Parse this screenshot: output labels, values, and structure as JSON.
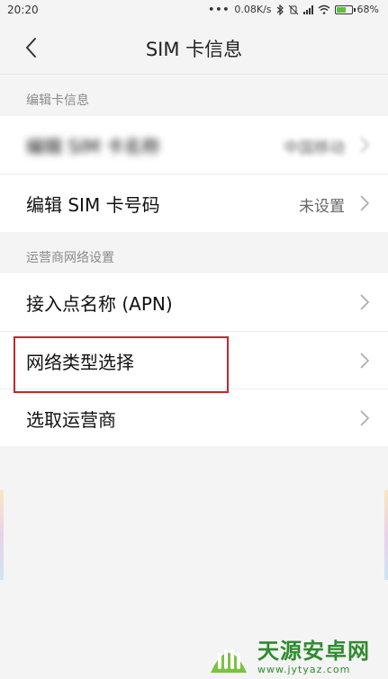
{
  "status_bar": {
    "time": "20:20",
    "dots": "•••",
    "net_speed": "0.08K/s",
    "battery": "68%",
    "battery_level": 0.68
  },
  "header": {
    "title": "SIM 卡信息"
  },
  "section_edit": {
    "label": "编辑卡信息",
    "rows": [
      {
        "label": "编辑 SIM 卡名称",
        "value": "中国移动",
        "blurred": true
      },
      {
        "label": "编辑 SIM 卡号码",
        "value": "未设置"
      }
    ]
  },
  "section_carrier": {
    "label": "运营商网络设置",
    "rows": [
      {
        "label": "接入点名称 (APN)"
      },
      {
        "label": "网络类型选择"
      },
      {
        "label": "选取运营商"
      }
    ]
  },
  "watermark": {
    "title": "天源安卓网",
    "url": "www.jytyaz.com"
  },
  "colors": {
    "highlight": "#c0272d",
    "brand_green": "#2f8a2f",
    "background": "#f4f4f4"
  },
  "icons": [
    "back-icon",
    "chevron-right-icon",
    "bluetooth-icon",
    "wifi-icon",
    "signal-icon",
    "battery-icon",
    "vibrate-off-icon"
  ]
}
